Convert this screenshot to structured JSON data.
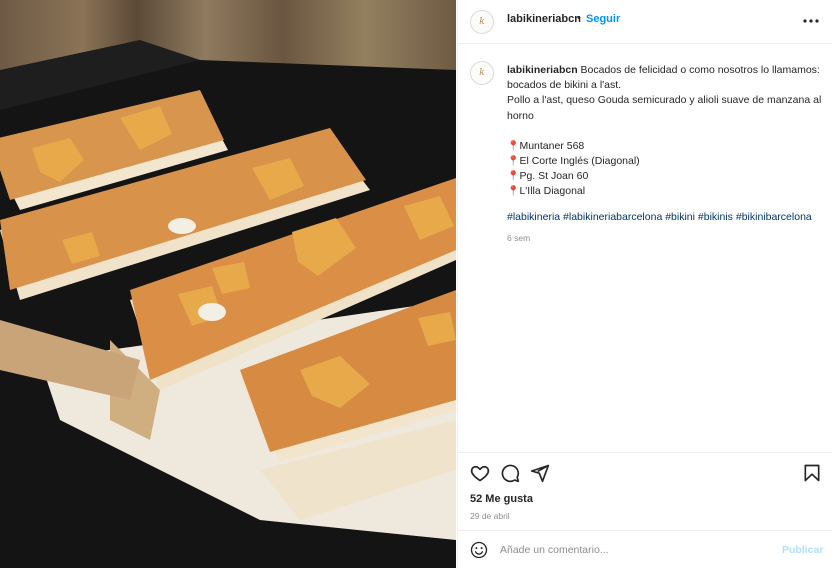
{
  "post": {
    "username": "labikineriabcn",
    "separator": "•",
    "follow_label": "Seguir",
    "avatar_letter": "k",
    "caption": {
      "username": "labikineriabcn",
      "line1": "Bocados de felicidad o como nosotros lo llamamos: bocados de bikini a l'ast.",
      "line2": "Pollo a l'ast, queso Gouda semicurado y alioli suave de manzana al horno",
      "locations": [
        {
          "pin": "📍",
          "text": "Muntaner 568"
        },
        {
          "pin": "📍",
          "text": "El Corte Inglés (Diagonal)"
        },
        {
          "pin": "📍",
          "text": "Pg. St Joan 60"
        },
        {
          "pin": "📍",
          "text": "L'Illa Diagonal"
        }
      ],
      "hashtags": [
        "#labikineria",
        "#labikineriabarcelona",
        "#bikini",
        "#bikinis",
        "#bikinibarcelona"
      ]
    },
    "caption_time": "6 sem",
    "likes": "52 Me gusta",
    "date": "29 de abril"
  },
  "icons": {
    "more": "more-options-icon",
    "like": "heart-icon",
    "comment": "comment-icon",
    "share": "share-icon",
    "save": "bookmark-icon",
    "emoji": "emoji-icon"
  },
  "comment": {
    "placeholder": "Añade un comentario...",
    "publish_label": "Publicar"
  },
  "colors": {
    "accent": "#0095f6",
    "hashtag": "#00376b",
    "publish_disabled": "#b2dffc",
    "muted": "#8e8e8e"
  }
}
